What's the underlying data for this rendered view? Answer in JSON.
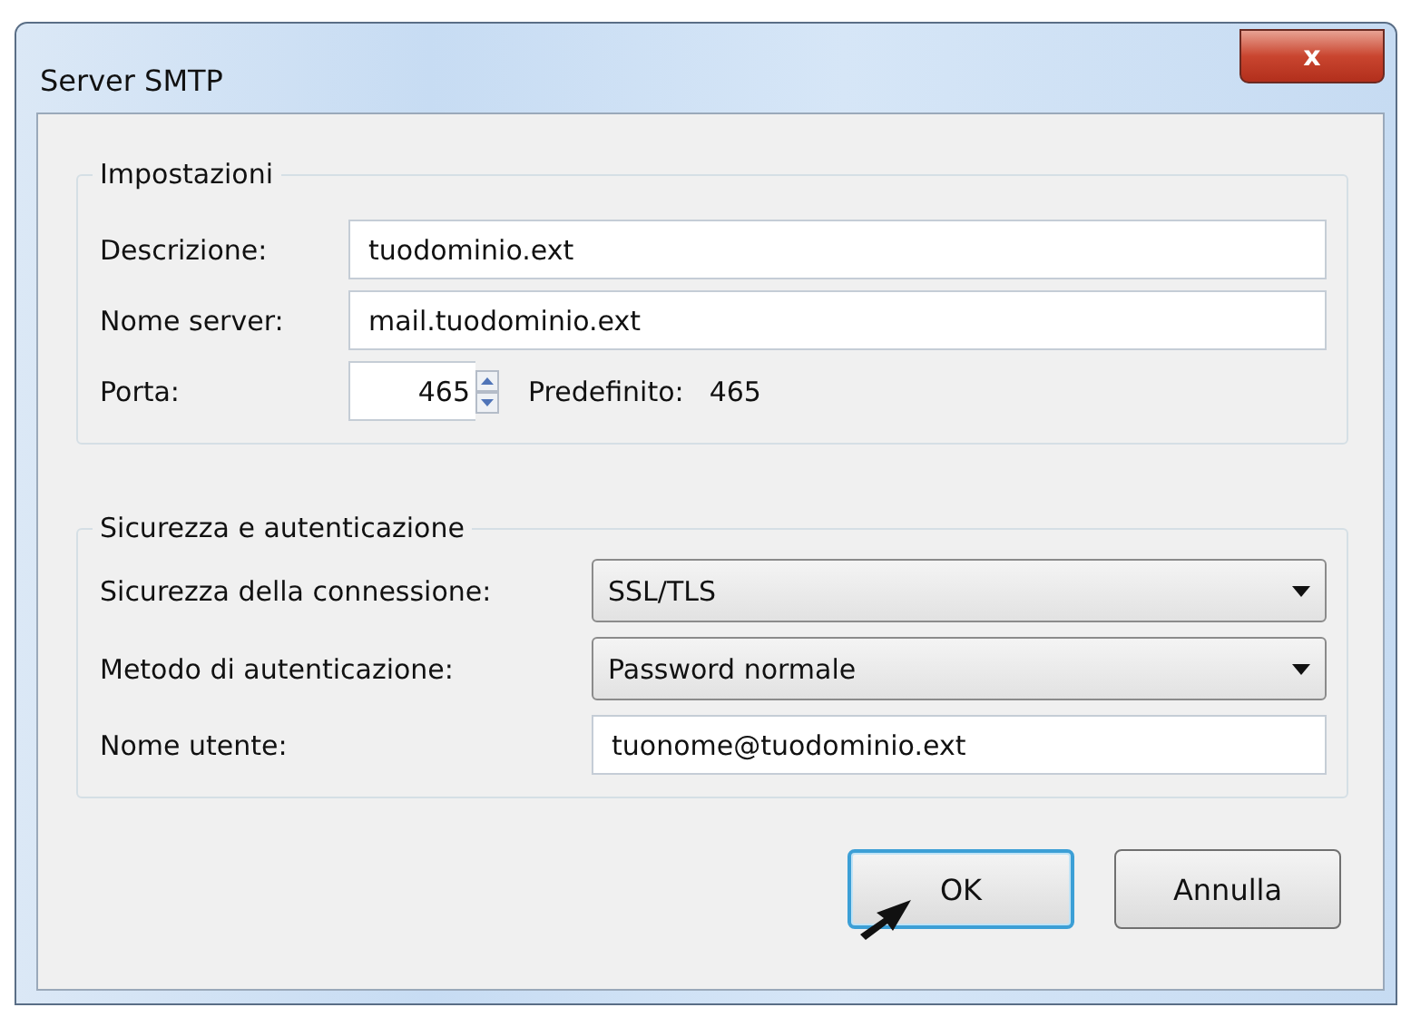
{
  "window": {
    "title": "Server SMTP",
    "close": "x"
  },
  "settings": {
    "legend": "Impostazioni",
    "fields": [
      {
        "kind": "text",
        "label": "Descrizione:",
        "value": "tuodominio.ext"
      },
      {
        "kind": "text",
        "label": "Nome server:",
        "value": "mail.tuodominio.ext"
      },
      {
        "kind": "spin",
        "label": "Porta:",
        "value": "465",
        "default_label": "Predefinito:",
        "default_value": "465"
      }
    ]
  },
  "security": {
    "legend": "Sicurezza e autenticazione",
    "fields": [
      {
        "kind": "select",
        "label": "Sicurezza della connessione:",
        "value": "SSL/TLS"
      },
      {
        "kind": "select",
        "label": "Metodo di autenticazione:",
        "value": "Password normale"
      },
      {
        "kind": "text",
        "label": "Nome utente:",
        "value": "tuonome@tuodominio.ext"
      }
    ]
  },
  "buttons": [
    {
      "label": "OK",
      "default": true
    },
    {
      "label": "Annulla",
      "default": false
    }
  ]
}
